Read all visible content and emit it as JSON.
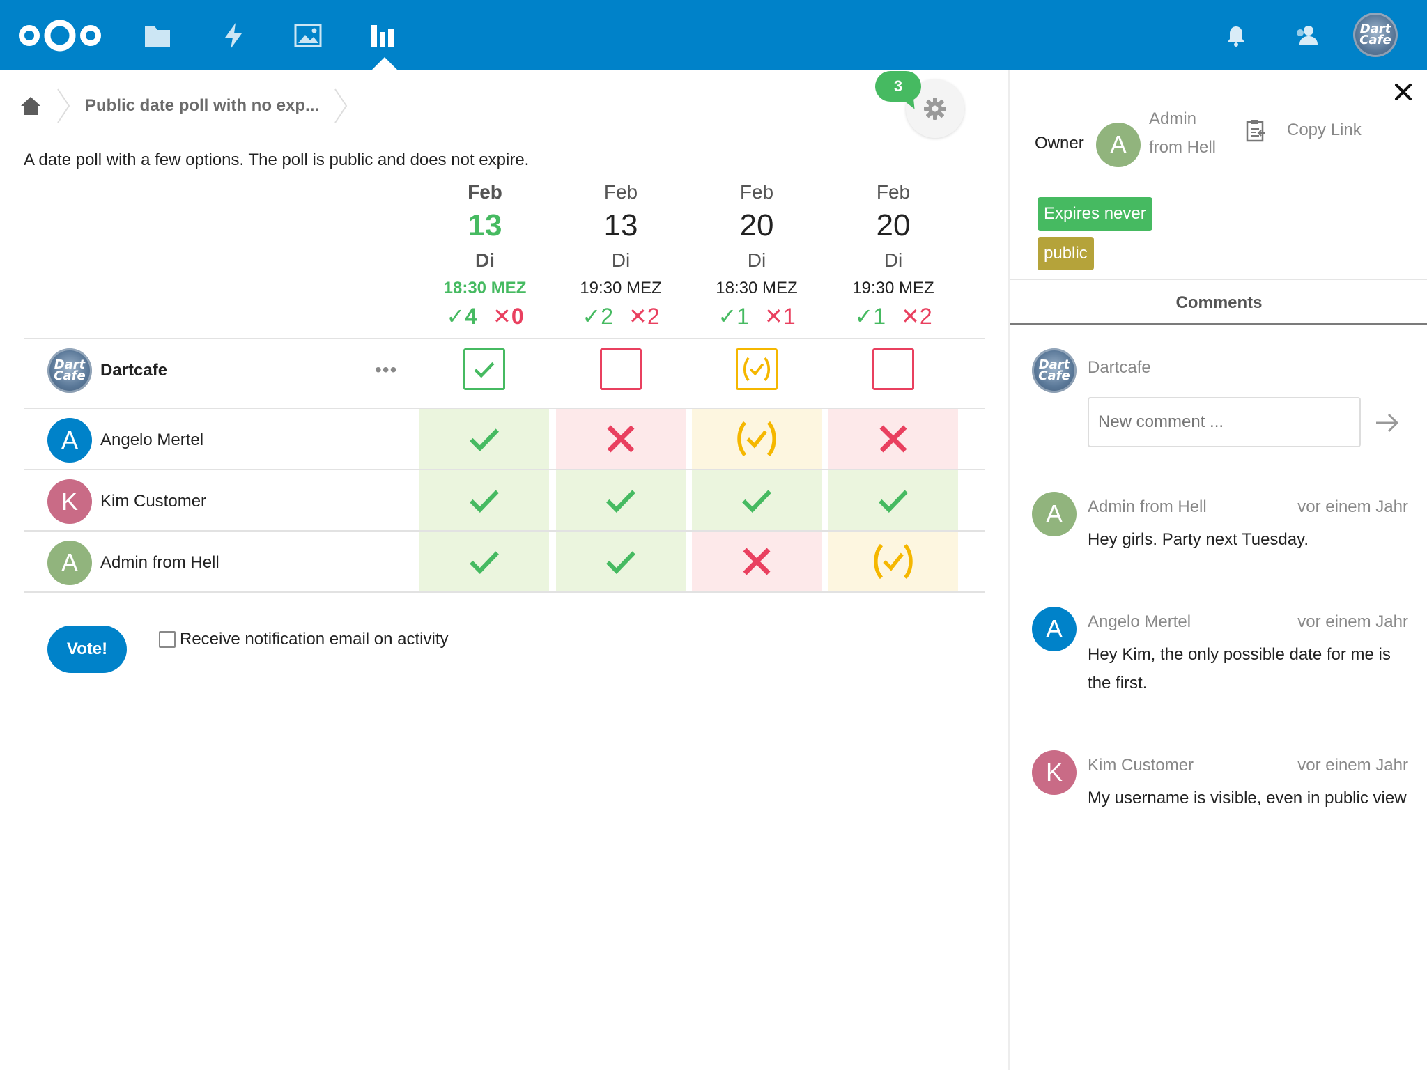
{
  "header": {
    "logo_icon": "nextcloud-logo-icon",
    "nav": [
      {
        "icon": "files-icon",
        "label": "Files"
      },
      {
        "icon": "activity-icon",
        "label": "Activity"
      },
      {
        "icon": "photos-icon",
        "label": "Photos"
      },
      {
        "icon": "polls-icon",
        "label": "Polls",
        "active": true
      }
    ],
    "right": [
      {
        "icon": "notifications-bell-icon"
      },
      {
        "icon": "contacts-icon"
      },
      {
        "icon": "user-avatar-icon",
        "avatar_text": [
          "Dart",
          "Cafe"
        ]
      }
    ],
    "brand_color": "#0082c9"
  },
  "breadcrumb": {
    "home_icon": "home-icon",
    "title": "Public date poll with no exp..."
  },
  "comments_badge": "3",
  "description": "A date poll with a few options. The poll is public and does not expire.",
  "options": [
    {
      "month": "Feb",
      "day": "13",
      "dow": "Di",
      "time": "18:30 MEZ",
      "yes": "4",
      "no": "0",
      "winner": true
    },
    {
      "month": "Feb",
      "day": "13",
      "dow": "Di",
      "time": "19:30 MEZ",
      "yes": "2",
      "no": "2",
      "winner": false
    },
    {
      "month": "Feb",
      "day": "20",
      "dow": "Di",
      "time": "18:30 MEZ",
      "yes": "1",
      "no": "1",
      "winner": false
    },
    {
      "month": "Feb",
      "day": "20",
      "dow": "Di",
      "time": "19:30 MEZ",
      "yes": "1",
      "no": "2",
      "winner": false
    }
  ],
  "current_user": {
    "name": "Dartcafe",
    "avatar_text": [
      "Dart",
      "Cafe"
    ],
    "menu": "•••",
    "votes": [
      "yes",
      "no",
      "maybe",
      "no"
    ]
  },
  "participants": [
    {
      "name": "Angelo Mertel",
      "initial": "A",
      "color": "#0082c9",
      "votes": [
        "yes",
        "no",
        "maybe",
        "no"
      ]
    },
    {
      "name": "Kim Customer",
      "initial": "K",
      "color": "#c96b86",
      "votes": [
        "yes",
        "yes",
        "yes",
        "yes"
      ]
    },
    {
      "name": "Admin from Hell",
      "initial": "A",
      "color": "#91b47d",
      "votes": [
        "yes",
        "yes",
        "no",
        "maybe"
      ]
    }
  ],
  "vote_button": "Vote!",
  "notify_label": "Receive notification email on activity",
  "sidebar": {
    "owner_label": "Owner",
    "owner_initial": "A",
    "owner_name": "Admin from Hell",
    "copy_link": "Copy Link",
    "badges": [
      {
        "label": "Expires never",
        "color": "#46ba61"
      },
      {
        "label": "public",
        "color": "#b5a33a"
      }
    ],
    "tab": "Comments",
    "me": "Dartcafe",
    "comment_placeholder": "New comment ...",
    "comments": [
      {
        "author": "Admin from Hell",
        "initial": "A",
        "color": "#91b47d",
        "time": "vor einem Jahr",
        "text": "Hey girls. Party next Tuesday."
      },
      {
        "author": "Angelo Mertel",
        "initial": "A",
        "color": "#0082c9",
        "time": "vor einem Jahr",
        "text": "Hey Kim, the only possible date for me is the first."
      },
      {
        "author": "Kim Customer",
        "initial": "K",
        "color": "#c96b86",
        "time": "vor einem Jahr",
        "text": "My username is visible, even in public view"
      }
    ]
  },
  "colors": {
    "yes": "#46ba61",
    "no": "#e9405f",
    "maybe": "#f5b700"
  }
}
